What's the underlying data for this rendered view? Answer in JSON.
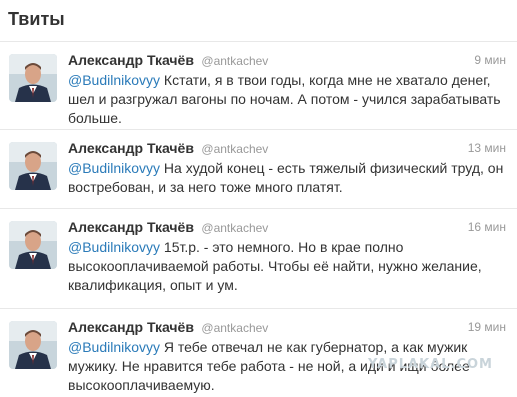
{
  "header": {
    "title": "Твиты"
  },
  "tweets": [
    {
      "name": "Александр Ткачёв",
      "handle": "@antkachev",
      "time": "9 мин",
      "mention": "@Budilnikovyy",
      "text": " Кстати, я в твои годы, когда мне не хватало денег, шел и разгружал вагоны по ночам. А потом - учился зарабатывать больше."
    },
    {
      "name": "Александр Ткачёв",
      "handle": "@antkachev",
      "time": "13 мин",
      "mention": "@Budilnikovyy",
      "text": " На худой конец - есть тяжелый физический труд, он востребован, и за него тоже много платят."
    },
    {
      "name": "Александр Ткачёв",
      "handle": "@antkachev",
      "time": "16 мин",
      "mention": "@Budilnikovyy",
      "text": " 15т.р. - это немного. Но в крае полно высокооплачиваемой работы. Чтобы её найти, нужно желание, квалификация, опыт и ум."
    },
    {
      "name": "Александр Ткачёв",
      "handle": "@antkachev",
      "time": "19 мин",
      "mention": "@Budilnikovyy",
      "text": " Я тебе отвечал не как губернатор, а как мужик мужику. Не нравится тебе работа - не ной, а иди и ищи более высокооплачиваемую."
    }
  ],
  "watermark": "YAPLAKAL.COM",
  "icons": {
    "avatar": "user-photo"
  },
  "colors": {
    "mention": "#2b7bb9",
    "muted": "#999999",
    "text": "#333333",
    "divider": "#e8e8e8"
  }
}
